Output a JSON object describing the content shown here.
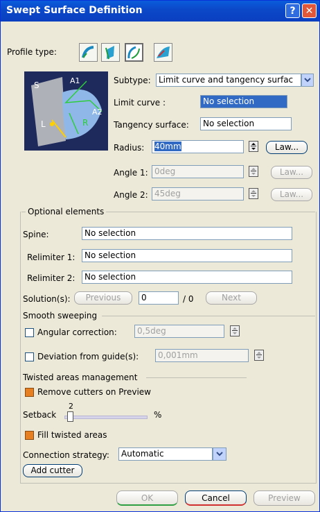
{
  "window": {
    "title": "Swept Surface Definition"
  },
  "profile_type": {
    "label": "Profile type:"
  },
  "diagram": {
    "labels": [
      "S",
      "A1",
      "A2",
      "L",
      "R"
    ]
  },
  "subtype": {
    "label": "Subtype:",
    "value": "Limit curve and tangency surfac"
  },
  "limit_curve": {
    "label": "Limit curve :",
    "value": "No selection"
  },
  "tangency_surface": {
    "label": "Tangency surface:",
    "value": "No selection"
  },
  "radius": {
    "label": "Radius:",
    "value": "40mm",
    "law_label": "Law..."
  },
  "angle1": {
    "label": "Angle 1:",
    "value": "0deg",
    "law_label": "Law..."
  },
  "angle2": {
    "label": "Angle 2:",
    "value": "45deg",
    "law_label": "Law..."
  },
  "optional": {
    "title": "Optional elements",
    "spine_label": "Spine:",
    "spine_value": "No selection",
    "relimiter1_label": "Relimiter 1:",
    "relimiter1_value": "No selection",
    "relimiter2_label": "Relimiter 2:",
    "relimiter2_value": "No selection",
    "solutions_label": "Solution(s):",
    "previous_label": "Previous",
    "solution_value": "0",
    "solution_total": "/ 0",
    "next_label": "Next"
  },
  "smooth": {
    "title": "Smooth sweeping",
    "angular_label": "Angular correction:",
    "angular_value": "0,5deg",
    "angular_checked": false,
    "deviation_label": "Deviation from guide(s):",
    "deviation_value": "0,001mm",
    "deviation_checked": false
  },
  "twisted": {
    "title": "Twisted areas management",
    "remove_label": "Remove cutters on Preview",
    "remove_checked": true,
    "setback_label": "Setback",
    "setback_value": "2",
    "setback_unit": "%",
    "fill_label": "Fill twisted areas",
    "fill_checked": true,
    "connection_label": "Connection strategy:",
    "connection_value": "Automatic",
    "add_cutter_label": "Add cutter"
  },
  "footer": {
    "ok_label": "OK",
    "cancel_label": "Cancel",
    "preview_label": "Preview"
  },
  "colors": {
    "title_bar": "#0b49c9",
    "close": "#e0573a",
    "selection": "#316ac5",
    "checked": "#e67e22"
  }
}
